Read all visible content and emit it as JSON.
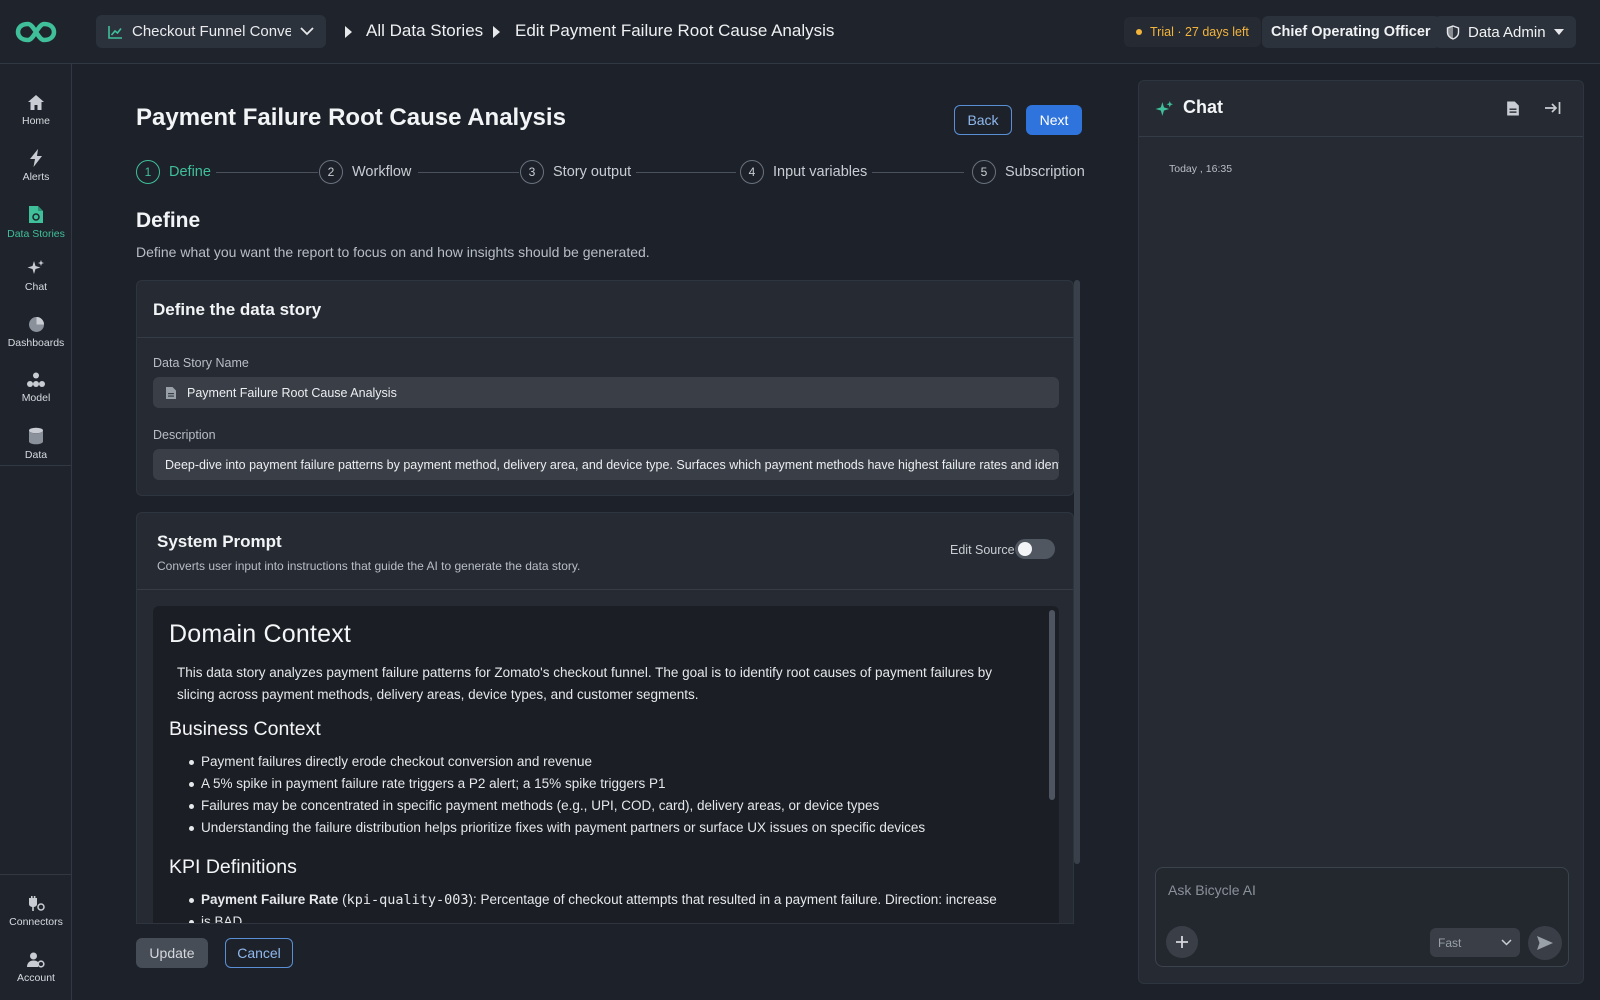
{
  "topbar": {
    "story_select_label": "Checkout Funnel Conver...",
    "breadcrumb": [
      "All Data Stories",
      "Edit Payment Failure Root Cause Analysis"
    ],
    "trial_text": "Trial · 27 days left",
    "role": "Chief Operating Officer",
    "admin_label": "Data Admin"
  },
  "sidebar": {
    "items": [
      {
        "label": "Home",
        "icon": "home-icon"
      },
      {
        "label": "Alerts",
        "icon": "bolt-icon"
      },
      {
        "label": "Data Stories",
        "icon": "document-icon",
        "active": true
      },
      {
        "label": "Chat",
        "icon": "sparkle-icon"
      },
      {
        "label": "Dashboards",
        "icon": "pie-chart-icon"
      },
      {
        "label": "Model",
        "icon": "model-icon"
      },
      {
        "label": "Data",
        "icon": "database-icon"
      }
    ],
    "bottom_items": [
      {
        "label": "Connectors",
        "icon": "plug-icon"
      },
      {
        "label": "Account",
        "icon": "user-gear-icon"
      }
    ]
  },
  "main": {
    "title": "Payment Failure Root Cause Analysis",
    "back_label": "Back",
    "next_label": "Next",
    "steps": [
      {
        "num": "1",
        "label": "Define",
        "active": true
      },
      {
        "num": "2",
        "label": "Workflow"
      },
      {
        "num": "3",
        "label": "Story output"
      },
      {
        "num": "4",
        "label": "Input variables"
      },
      {
        "num": "5",
        "label": "Subscription"
      }
    ],
    "section_title": "Define",
    "section_subtitle": "Define what you want the report to focus on and how insights should be generated.",
    "define_card": {
      "title": "Define the data story",
      "name_label": "Data Story Name",
      "name_value": "Payment Failure Root Cause Analysis",
      "description_label": "Description",
      "description_value": "Deep-dive into payment failure patterns by payment method, delivery area, and device type. Surfaces which payment methods have highest failure rates and identifies"
    },
    "system_prompt": {
      "title": "System Prompt",
      "subtitle": "Converts user input into instructions that guide the AI to generate the data story.",
      "edit_source_label": "Edit Source",
      "edit_source_on": false,
      "h_domain": "Domain Context",
      "domain_text": "This data story analyzes payment failure patterns for Zomato's checkout funnel. The goal is to identify root causes of payment failures by slicing across payment methods, delivery areas, device types, and customer segments.",
      "h_business": "Business Context",
      "business_bullets": [
        "Payment failures directly erode checkout conversion and revenue",
        "A 5% spike in payment failure rate triggers a P2 alert; a 15% spike triggers P1",
        "Failures may be concentrated in specific payment methods (e.g., UPI, COD, card), delivery areas, or device types",
        "Understanding the failure distribution helps prioritize fixes with payment partners or surface UX issues on specific devices"
      ],
      "h_kpi": "KPI Definitions",
      "kpi_name": "Payment Failure Rate",
      "kpi_code": "kpi-quality-003",
      "kpi_text": ": Percentage of checkout attempts that resulted in a payment failure. Direction: increase",
      "kpi_cut": "is BAD"
    },
    "update_label": "Update",
    "cancel_label": "Cancel"
  },
  "chat": {
    "title": "Chat",
    "timestamp": "Today , 16:35",
    "input_placeholder": "Ask Bicycle AI",
    "mode": "Fast"
  },
  "colors": {
    "accent_green": "#3fbf9a",
    "primary_blue": "#2f74dc",
    "trial_orange": "#f3b43c"
  }
}
